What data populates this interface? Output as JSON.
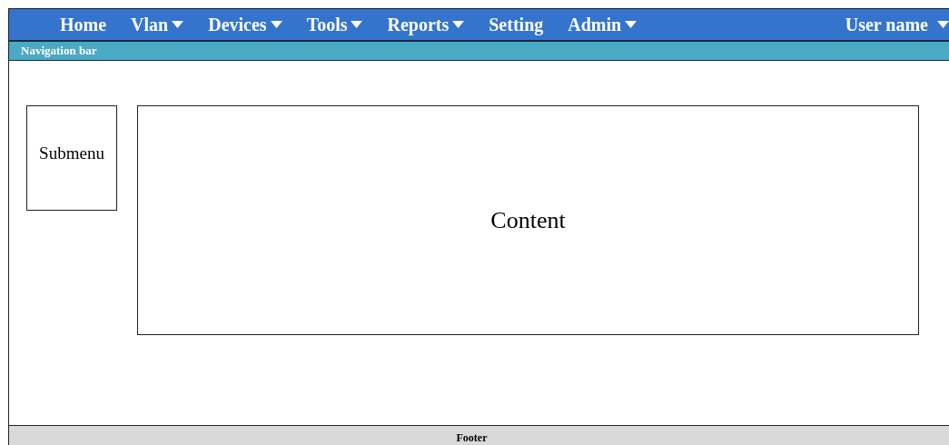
{
  "menu": [
    {
      "label": "Home",
      "has_menu": false
    },
    {
      "label": "Vlan",
      "has_menu": true
    },
    {
      "label": "Devices",
      "has_menu": true
    },
    {
      "label": "Tools",
      "has_menu": true
    },
    {
      "label": "Reports",
      "has_menu": true
    },
    {
      "label": "Setting",
      "has_menu": false
    },
    {
      "label": "Admin",
      "has_menu": true
    }
  ],
  "user": {
    "label": "User name",
    "has_menu": true
  },
  "nav_bar": "Navigation bar",
  "submenu": "Submenu",
  "content": "Content",
  "footer": "Footer"
}
